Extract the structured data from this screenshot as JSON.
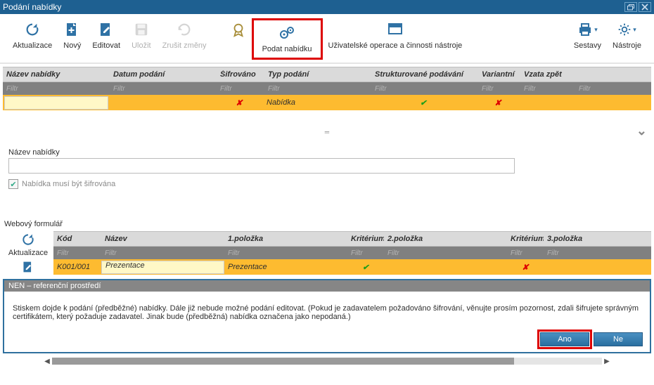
{
  "titlebar": {
    "title": "Podání nabídky"
  },
  "toolbar": {
    "refresh": "Aktualizace",
    "new": "Nový",
    "edit": "Editovat",
    "save": "Uložit",
    "cancel": "Zrušit změny",
    "submit": "Podat nabídku",
    "userops": "Uživatelské operace a činnosti nástroje",
    "reports": "Sestavy",
    "tools": "Nástroje"
  },
  "grid1": {
    "headers": {
      "nazev": "Název nabídky",
      "datum": "Datum podání",
      "sifrovano": "Šifrováno",
      "typ": "Typ podání",
      "struktur": "Strukturované podávání",
      "variant": "Variantní",
      "vzata": "Vzata zpět"
    },
    "filter_placeholder": "Filtr",
    "row": {
      "typ": "Nabídka"
    }
  },
  "detail": {
    "nazev_label": "Název nabídky",
    "check_label": "Nabídka musí být šifrována"
  },
  "section2_label": "Webový formulář",
  "grid2": {
    "side_refresh": "Aktualizace",
    "headers": {
      "kod": "Kód",
      "nazev": "Název",
      "p1": "1.položka",
      "k1": "Kritérium",
      "p2": "2.položka",
      "k2": "Kritérium",
      "p3": "3.položka"
    },
    "filter_placeholder": "Filtr",
    "row": {
      "kod": "K001/001",
      "nazev": "Prezentace",
      "p1": "Prezentace"
    }
  },
  "dialog": {
    "title": "NEN – referenční prostředí",
    "body": "Stiskem dojde k podání (předběžné) nabídky. Dále již nebude možné podání editovat. (Pokud je zadavatelem požadováno šifrování, věnujte prosím pozornost, zdali šifrujete správným certifikátem, který požaduje zadavatel. Jinak bude (předběžná) nabídka označena jako nepodaná.)",
    "yes": "Ano",
    "no": "Ne"
  }
}
